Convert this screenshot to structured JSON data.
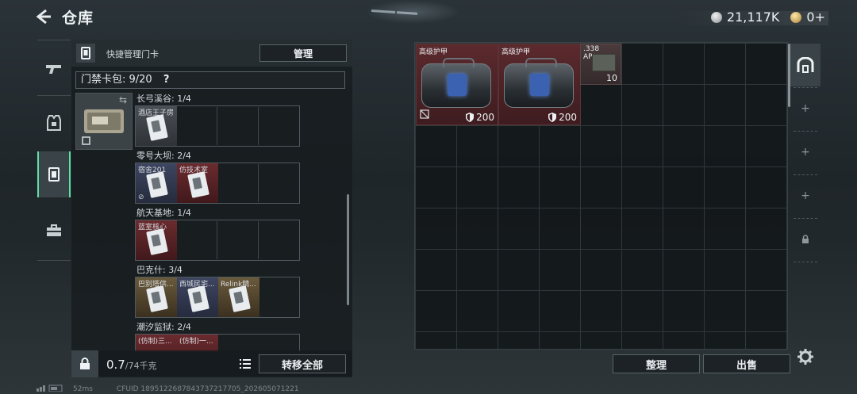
{
  "header": {
    "title": "仓库",
    "currencies": [
      {
        "icon": "silver-coin-icon",
        "value": "21,117K"
      },
      {
        "icon": "gold-coin-icon",
        "value": "0+"
      }
    ]
  },
  "left_nav": {
    "tabs": [
      {
        "name": "tab-weapons",
        "icon": "gun-icon"
      },
      {
        "name": "tab-armor",
        "icon": "vest-icon"
      },
      {
        "name": "tab-keycards",
        "icon": "keycard-icon",
        "active": true
      },
      {
        "name": "tab-toolbox",
        "icon": "toolbox-icon"
      }
    ]
  },
  "keycard_panel": {
    "header_label": "快捷管理门卡",
    "manage_label": "管理",
    "keybag_label": "门禁卡包: 9/20",
    "keybag_help": "?",
    "groups": [
      {
        "label": "长弓溪谷: 1/4",
        "cards": [
          {
            "name": "酒店王子房",
            "color": "gray"
          }
        ]
      },
      {
        "label": "零号大坝: 2/4",
        "cards": [
          {
            "name": "宿舍201",
            "color": "blue"
          },
          {
            "name": "仿技术室",
            "color": "red"
          }
        ]
      },
      {
        "label": "航天基地: 1/4",
        "cards": [
          {
            "name": "蓝室核心",
            "color": "red"
          }
        ]
      },
      {
        "label": "巴克什: 3/4",
        "cards": [
          {
            "name": "巴别塔供...",
            "color": "gold"
          },
          {
            "name": "西城民宅...",
            "color": "blue"
          },
          {
            "name": "Relink精...",
            "color": "gold"
          }
        ]
      },
      {
        "label": "潮汐监狱: 2/4",
        "cards": [
          {
            "name": "(仿制)三...",
            "color": "red"
          },
          {
            "name": "(仿制)一...",
            "color": "red"
          }
        ]
      }
    ],
    "weight_value": "0.7",
    "weight_unit": "/74千克",
    "transfer_all_label": "转移全部"
  },
  "storage": {
    "items": [
      {
        "name": "高级护甲",
        "durability": "200"
      },
      {
        "name": "高级护甲",
        "durability": "200"
      }
    ],
    "ammo": {
      "name": ".338\nAP",
      "count": "10"
    },
    "sort_label": "整理",
    "sell_label": "出售"
  },
  "status_bar": {
    "ping": "52ms",
    "uid": "CFUID 1895122687843737217705_202605071221"
  }
}
